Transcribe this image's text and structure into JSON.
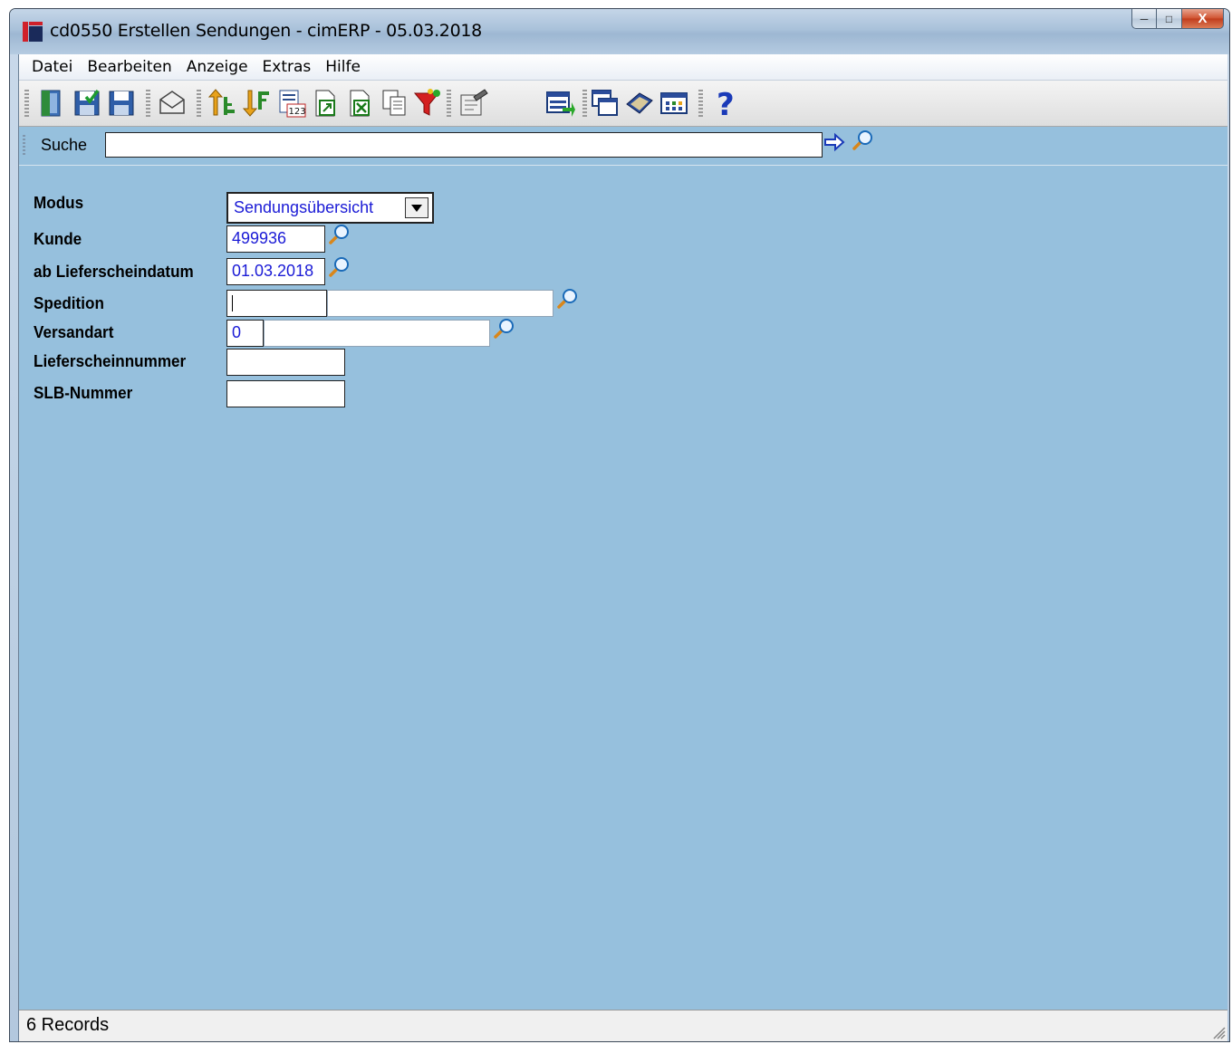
{
  "window": {
    "title": "cd0550 Erstellen Sendungen - cimERP - 05.03.2018",
    "buttons": {
      "minimize": "─",
      "maximize": "□",
      "close": "X"
    }
  },
  "menu": [
    "Datei",
    "Bearbeiten",
    "Anzeige",
    "Extras",
    "Hilfe"
  ],
  "toolbar": {
    "icons": [
      "exit-icon",
      "save-check-icon",
      "save-icon",
      "mail-icon",
      "sort-ascending-icon",
      "sort-descending-icon",
      "calendar-123-icon",
      "export-document-icon",
      "excel-export-icon",
      "copy-document-icon",
      "filter-icon",
      "edit-properties-icon",
      "layout-icon",
      "windows-icon",
      "book-icon",
      "grid-icon",
      "help-icon"
    ]
  },
  "search": {
    "label": "Suche",
    "value": ""
  },
  "form": {
    "modus": {
      "label": "Modus",
      "value": "Sendungsübersicht"
    },
    "kunde": {
      "label": "Kunde",
      "value": "499936"
    },
    "lieferscheindatum": {
      "label": "ab Lieferscheindatum",
      "value": "01.03.2018"
    },
    "spedition": {
      "label": "Spedition",
      "code": "",
      "name": ""
    },
    "versandart": {
      "label": "Versandart",
      "code": "0",
      "name": ""
    },
    "lieferscheinnummer": {
      "label": "Lieferscheinnummer",
      "value": ""
    },
    "slb_nummer": {
      "label": "SLB-Nummer",
      "value": ""
    }
  },
  "status": {
    "text": "6 Records"
  },
  "colors": {
    "background": "#96c0dd",
    "field_text": "#1b1bd6"
  }
}
